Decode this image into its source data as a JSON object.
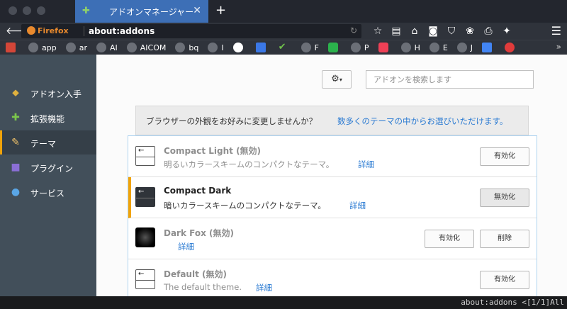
{
  "tab": {
    "title": "アドオンマネージャー",
    "close": "✕",
    "new_tab": "+"
  },
  "navbar": {
    "brand": "Firefox",
    "url": "about:addons",
    "icons": [
      "star-icon",
      "reader-icon",
      "home-icon",
      "pocket-icon",
      "shield-icon",
      "evernote-icon",
      "print-icon",
      "extension-icon"
    ]
  },
  "bookmarks": [
    {
      "label": "",
      "icon": "gmail-icon"
    },
    {
      "label": "app",
      "icon": "globe-icon"
    },
    {
      "label": "ar",
      "icon": "globe-icon"
    },
    {
      "label": "AI",
      "icon": "globe-icon"
    },
    {
      "label": "AICOM",
      "icon": "globe-icon"
    },
    {
      "label": "bq",
      "icon": "globe-icon"
    },
    {
      "label": "I",
      "icon": "globe-icon"
    },
    {
      "label": "",
      "icon": "google-icon"
    },
    {
      "label": "",
      "icon": "calendar-icon"
    },
    {
      "label": "",
      "icon": "check-icon"
    },
    {
      "label": "F",
      "icon": "globe-icon"
    },
    {
      "label": "",
      "icon": "feedly-icon"
    },
    {
      "label": "P",
      "icon": "globe-icon"
    },
    {
      "label": "",
      "icon": "pocket-icon"
    },
    {
      "label": "H",
      "icon": "globe-icon"
    },
    {
      "label": "E",
      "icon": "globe-icon"
    },
    {
      "label": "J",
      "icon": "globe-icon"
    },
    {
      "label": "",
      "icon": "translate-icon"
    },
    {
      "label": "",
      "icon": "red-icon"
    }
  ],
  "sidebar": {
    "items": [
      {
        "label": "アドオン入手",
        "icon": "puzzle-get-icon"
      },
      {
        "label": "拡張機能",
        "icon": "puzzle-icon"
      },
      {
        "label": "テーマ",
        "icon": "palette-icon"
      },
      {
        "label": "プラグイン",
        "icon": "plugin-icon"
      },
      {
        "label": "サービス",
        "icon": "chat-icon"
      }
    ]
  },
  "search": {
    "placeholder": "アドオンを検索します"
  },
  "banner": {
    "text": "ブラウザーの外観をお好みに変更しませんか？",
    "link": "数多くのテーマの中からお選びいただけます。"
  },
  "themes": [
    {
      "name": "Compact Light  (無効)",
      "desc": "明るいカラースキームのコンパクトなテーマ。",
      "more": "詳細",
      "buttons": [
        "有効化"
      ]
    },
    {
      "name": "Compact Dark",
      "desc": "暗いカラースキームのコンパクトなテーマ。",
      "more": "詳細",
      "buttons": [
        "無効化"
      ]
    },
    {
      "name": "Dark Fox  (無効)",
      "desc": "",
      "more": "詳細",
      "buttons": [
        "有効化",
        "削除"
      ]
    },
    {
      "name": "Default  (無効)",
      "desc": "The default theme.",
      "more": "詳細",
      "buttons": [
        "有効化"
      ]
    }
  ],
  "status": {
    "text": "about:addons <[1/1]All"
  },
  "colors": {
    "accent": "#f0a30a",
    "link": "#2a7ad2",
    "tab": "#3d6fb6",
    "sidebar": "#424f5a"
  }
}
